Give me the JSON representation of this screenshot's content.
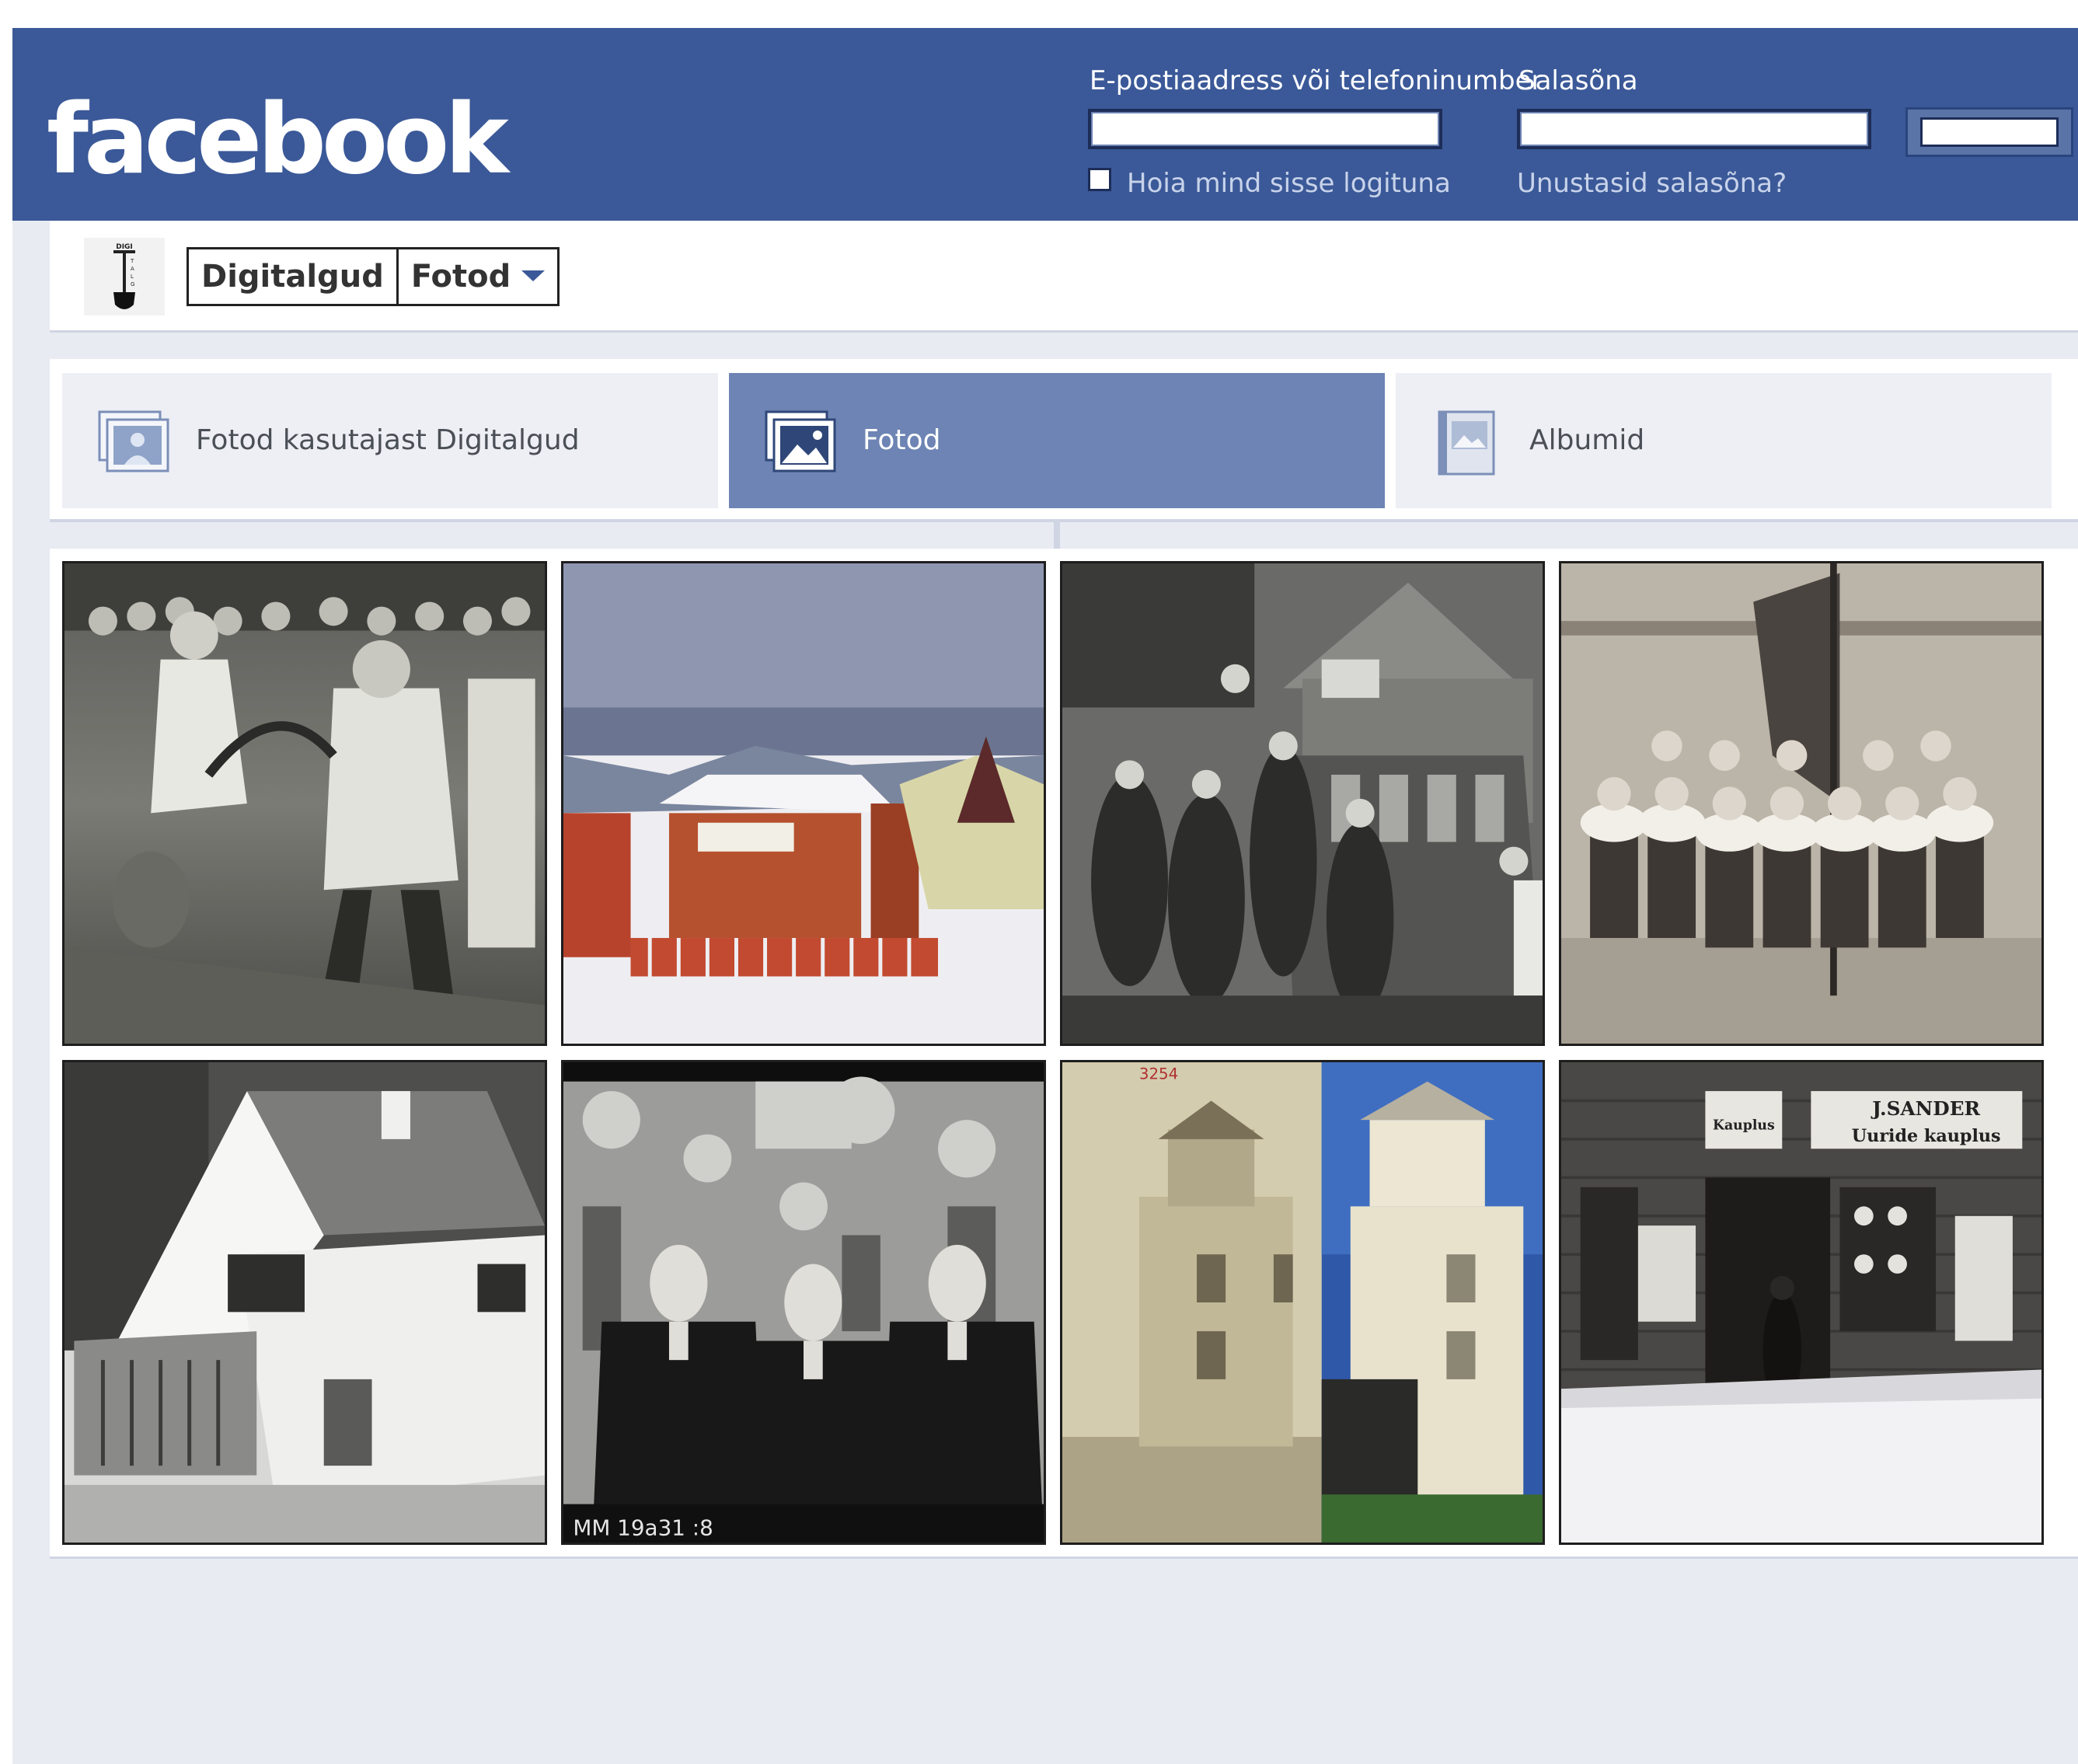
{
  "header": {
    "logo": "facebook",
    "email_label": "E-postiaadress või telefoninumber",
    "password_label": "Salasõna",
    "remember_label": "Hoia mind sisse logituna",
    "forgot_link": "Unustasid salasõna?",
    "email_value": "",
    "password_value": ""
  },
  "page": {
    "name": "Digitalgud",
    "section": "Fotod",
    "avatar_text": "DIGI TALGUD"
  },
  "tabs": [
    {
      "label": "Fotod kasutajast Digitalgud",
      "icon": "photos-of-user-icon",
      "active": false
    },
    {
      "label": "Fotod",
      "icon": "photos-icon",
      "active": true
    },
    {
      "label": "Albumid",
      "icon": "albums-icon",
      "active": false
    }
  ],
  "photos": [
    {
      "subject": "crowd-outdoor"
    },
    {
      "subject": "winter-house-painting"
    },
    {
      "subject": "crowded-tram"
    },
    {
      "subject": "schoolgirls-with-flag"
    },
    {
      "subject": "white-house"
    },
    {
      "subject": "three-men-in-uniform"
    },
    {
      "subject": "tower-building-then-and-now"
    },
    {
      "subject": "shop-front-in-snow"
    }
  ],
  "photo_texts": {
    "p6_caption": "MM 19a31 :8",
    "p7_number": "3254",
    "p8_sign_main": "J.SANDER",
    "p8_sign_sub": "Uuride kauplus",
    "p8_small_sign": "Kauplus"
  },
  "colors": {
    "brand": "#3b5998",
    "active_tab": "#6d84b4",
    "page_bg": "#e9ebf3"
  }
}
